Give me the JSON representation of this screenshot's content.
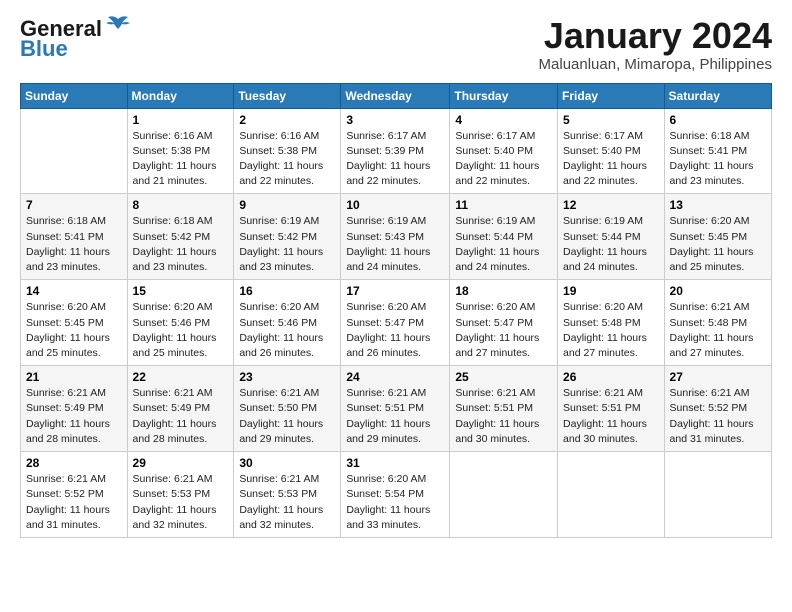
{
  "logo": {
    "line1": "General",
    "line2": "Blue"
  },
  "title": "January 2024",
  "subtitle": "Maluanluan, Mimaropa, Philippines",
  "days_of_week": [
    "Sunday",
    "Monday",
    "Tuesday",
    "Wednesday",
    "Thursday",
    "Friday",
    "Saturday"
  ],
  "weeks": [
    [
      {
        "day": "",
        "sunrise": "",
        "sunset": "",
        "daylight": ""
      },
      {
        "day": "1",
        "sunrise": "Sunrise: 6:16 AM",
        "sunset": "Sunset: 5:38 PM",
        "daylight": "Daylight: 11 hours and 21 minutes."
      },
      {
        "day": "2",
        "sunrise": "Sunrise: 6:16 AM",
        "sunset": "Sunset: 5:38 PM",
        "daylight": "Daylight: 11 hours and 22 minutes."
      },
      {
        "day": "3",
        "sunrise": "Sunrise: 6:17 AM",
        "sunset": "Sunset: 5:39 PM",
        "daylight": "Daylight: 11 hours and 22 minutes."
      },
      {
        "day": "4",
        "sunrise": "Sunrise: 6:17 AM",
        "sunset": "Sunset: 5:40 PM",
        "daylight": "Daylight: 11 hours and 22 minutes."
      },
      {
        "day": "5",
        "sunrise": "Sunrise: 6:17 AM",
        "sunset": "Sunset: 5:40 PM",
        "daylight": "Daylight: 11 hours and 22 minutes."
      },
      {
        "day": "6",
        "sunrise": "Sunrise: 6:18 AM",
        "sunset": "Sunset: 5:41 PM",
        "daylight": "Daylight: 11 hours and 23 minutes."
      }
    ],
    [
      {
        "day": "7",
        "sunrise": "Sunrise: 6:18 AM",
        "sunset": "Sunset: 5:41 PM",
        "daylight": "Daylight: 11 hours and 23 minutes."
      },
      {
        "day": "8",
        "sunrise": "Sunrise: 6:18 AM",
        "sunset": "Sunset: 5:42 PM",
        "daylight": "Daylight: 11 hours and 23 minutes."
      },
      {
        "day": "9",
        "sunrise": "Sunrise: 6:19 AM",
        "sunset": "Sunset: 5:42 PM",
        "daylight": "Daylight: 11 hours and 23 minutes."
      },
      {
        "day": "10",
        "sunrise": "Sunrise: 6:19 AM",
        "sunset": "Sunset: 5:43 PM",
        "daylight": "Daylight: 11 hours and 24 minutes."
      },
      {
        "day": "11",
        "sunrise": "Sunrise: 6:19 AM",
        "sunset": "Sunset: 5:44 PM",
        "daylight": "Daylight: 11 hours and 24 minutes."
      },
      {
        "day": "12",
        "sunrise": "Sunrise: 6:19 AM",
        "sunset": "Sunset: 5:44 PM",
        "daylight": "Daylight: 11 hours and 24 minutes."
      },
      {
        "day": "13",
        "sunrise": "Sunrise: 6:20 AM",
        "sunset": "Sunset: 5:45 PM",
        "daylight": "Daylight: 11 hours and 25 minutes."
      }
    ],
    [
      {
        "day": "14",
        "sunrise": "Sunrise: 6:20 AM",
        "sunset": "Sunset: 5:45 PM",
        "daylight": "Daylight: 11 hours and 25 minutes."
      },
      {
        "day": "15",
        "sunrise": "Sunrise: 6:20 AM",
        "sunset": "Sunset: 5:46 PM",
        "daylight": "Daylight: 11 hours and 25 minutes."
      },
      {
        "day": "16",
        "sunrise": "Sunrise: 6:20 AM",
        "sunset": "Sunset: 5:46 PM",
        "daylight": "Daylight: 11 hours and 26 minutes."
      },
      {
        "day": "17",
        "sunrise": "Sunrise: 6:20 AM",
        "sunset": "Sunset: 5:47 PM",
        "daylight": "Daylight: 11 hours and 26 minutes."
      },
      {
        "day": "18",
        "sunrise": "Sunrise: 6:20 AM",
        "sunset": "Sunset: 5:47 PM",
        "daylight": "Daylight: 11 hours and 27 minutes."
      },
      {
        "day": "19",
        "sunrise": "Sunrise: 6:20 AM",
        "sunset": "Sunset: 5:48 PM",
        "daylight": "Daylight: 11 hours and 27 minutes."
      },
      {
        "day": "20",
        "sunrise": "Sunrise: 6:21 AM",
        "sunset": "Sunset: 5:48 PM",
        "daylight": "Daylight: 11 hours and 27 minutes."
      }
    ],
    [
      {
        "day": "21",
        "sunrise": "Sunrise: 6:21 AM",
        "sunset": "Sunset: 5:49 PM",
        "daylight": "Daylight: 11 hours and 28 minutes."
      },
      {
        "day": "22",
        "sunrise": "Sunrise: 6:21 AM",
        "sunset": "Sunset: 5:49 PM",
        "daylight": "Daylight: 11 hours and 28 minutes."
      },
      {
        "day": "23",
        "sunrise": "Sunrise: 6:21 AM",
        "sunset": "Sunset: 5:50 PM",
        "daylight": "Daylight: 11 hours and 29 minutes."
      },
      {
        "day": "24",
        "sunrise": "Sunrise: 6:21 AM",
        "sunset": "Sunset: 5:51 PM",
        "daylight": "Daylight: 11 hours and 29 minutes."
      },
      {
        "day": "25",
        "sunrise": "Sunrise: 6:21 AM",
        "sunset": "Sunset: 5:51 PM",
        "daylight": "Daylight: 11 hours and 30 minutes."
      },
      {
        "day": "26",
        "sunrise": "Sunrise: 6:21 AM",
        "sunset": "Sunset: 5:51 PM",
        "daylight": "Daylight: 11 hours and 30 minutes."
      },
      {
        "day": "27",
        "sunrise": "Sunrise: 6:21 AM",
        "sunset": "Sunset: 5:52 PM",
        "daylight": "Daylight: 11 hours and 31 minutes."
      }
    ],
    [
      {
        "day": "28",
        "sunrise": "Sunrise: 6:21 AM",
        "sunset": "Sunset: 5:52 PM",
        "daylight": "Daylight: 11 hours and 31 minutes."
      },
      {
        "day": "29",
        "sunrise": "Sunrise: 6:21 AM",
        "sunset": "Sunset: 5:53 PM",
        "daylight": "Daylight: 11 hours and 32 minutes."
      },
      {
        "day": "30",
        "sunrise": "Sunrise: 6:21 AM",
        "sunset": "Sunset: 5:53 PM",
        "daylight": "Daylight: 11 hours and 32 minutes."
      },
      {
        "day": "31",
        "sunrise": "Sunrise: 6:20 AM",
        "sunset": "Sunset: 5:54 PM",
        "daylight": "Daylight: 11 hours and 33 minutes."
      },
      {
        "day": "",
        "sunrise": "",
        "sunset": "",
        "daylight": ""
      },
      {
        "day": "",
        "sunrise": "",
        "sunset": "",
        "daylight": ""
      },
      {
        "day": "",
        "sunrise": "",
        "sunset": "",
        "daylight": ""
      }
    ]
  ]
}
